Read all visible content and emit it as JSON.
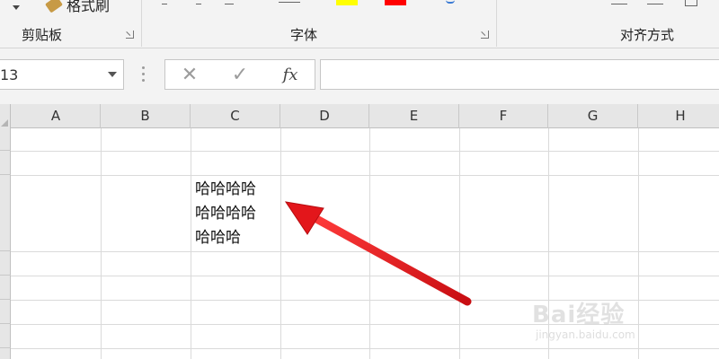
{
  "ribbon": {
    "format_painter_label": "格式刷",
    "groups": [
      {
        "label": "剪贴板"
      },
      {
        "label": "字体"
      },
      {
        "label": "对齐方式"
      }
    ],
    "colors": {
      "highlight": "#ffff00",
      "font_color": "#ff0000"
    }
  },
  "formula_bar": {
    "name_box_value": "13",
    "cancel_symbol": "✕",
    "enter_symbol": "✓",
    "fx_label": "fx",
    "formula_value": ""
  },
  "sheet": {
    "columns": [
      "A",
      "B",
      "C",
      "D",
      "E",
      "F",
      "G",
      "H"
    ],
    "active_cell_text": "哈哈哈哈\n哈哈哈哈\n哈哈哈"
  },
  "annotation": {
    "arrow_color": "#e3161b"
  },
  "watermark": {
    "brand": "Bai经验",
    "url": "jingyan.baidu.com"
  }
}
